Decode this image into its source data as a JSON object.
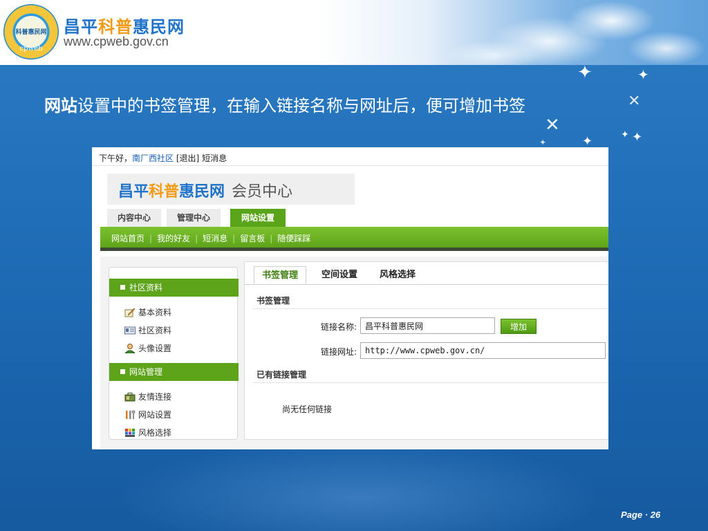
{
  "header": {
    "title_parts": [
      "昌平",
      "科普",
      "惠民网"
    ],
    "url": "www.cpweb.gov.cn",
    "seal": {
      "center_text": "科普惠民网",
      "ring_text_bottom": "cpweb"
    }
  },
  "headline": {
    "emphasis": "网站",
    "rest": "设置中的书签管理，在输入链接名称与网址后，便可增加书签"
  },
  "page": {
    "label": "Page",
    "separator": "·",
    "number": "26"
  },
  "screenshot": {
    "topbar": {
      "greeting": "下午好，",
      "user": "南厂西社区",
      "logout": "[退出]",
      "messages": "短消息"
    },
    "member_logo": {
      "parts": [
        "昌平",
        "科普",
        "惠民网"
      ],
      "suffix": "会员中心"
    },
    "main_tabs": [
      {
        "label": "内容中心",
        "active": false
      },
      {
        "label": "管理中心",
        "active": false
      },
      {
        "label": "网站设置",
        "active": true
      }
    ],
    "subnav": [
      "网站首页",
      "我的好友",
      "短消息",
      "留言板",
      "随便踩踩"
    ],
    "subnav_separator": "|",
    "sidebar": {
      "groups": [
        {
          "title": "社区资料",
          "items": [
            {
              "label": "基本资料",
              "icon": "pencil-note-icon"
            },
            {
              "label": "社区资料",
              "icon": "id-card-icon"
            },
            {
              "label": "头像设置",
              "icon": "user-icon"
            }
          ]
        },
        {
          "title": "网站管理",
          "items": [
            {
              "label": "友情连接",
              "icon": "briefcase-icon"
            },
            {
              "label": "网站设置",
              "icon": "tools-icon"
            },
            {
              "label": "风格选择",
              "icon": "palette-grid-icon"
            }
          ]
        }
      ]
    },
    "panel_tabs": [
      {
        "label": "书签管理",
        "active": true
      },
      {
        "label": "空间设置",
        "active": false
      },
      {
        "label": "风格选择",
        "active": false
      }
    ],
    "bookmark_section": {
      "title": "书签管理",
      "name_label": "链接名称:",
      "name_value": "昌平科普惠民网",
      "add_button": "增加",
      "url_label": "链接网址:",
      "url_value": "http://www.cpweb.gov.cn/"
    },
    "existing_section": {
      "title": "已有链接管理",
      "empty_text": "尚无任何链接"
    }
  },
  "colors": {
    "slide_blue": "#2270ba",
    "brand_blue": "#1f73c9",
    "brand_orange": "#f39a16",
    "nav_green": "#5da41a"
  }
}
